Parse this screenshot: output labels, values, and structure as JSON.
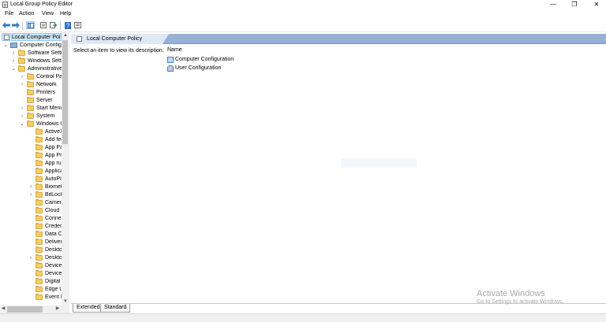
{
  "window": {
    "title": "Local Group Policy Editor",
    "minimize_glyph": "—",
    "restore_glyph": "❐",
    "close_glyph": "✕"
  },
  "menu": [
    "File",
    "Action",
    "View",
    "Help"
  ],
  "toolbar": {
    "back_icon": "back-arrow-icon",
    "forward_icon": "forward-arrow-icon",
    "show_tree_icon": "console-tree-icon",
    "properties_icon": "properties-icon",
    "export_icon": "export-list-icon",
    "help_icon": "help-icon",
    "filter_icon": "filter-icon"
  },
  "tree": {
    "root": "Local Computer Policy",
    "items": [
      {
        "label": "Computer Configuration",
        "expanded": true,
        "icon": "computer-icon"
      },
      {
        "label": "Software Settings",
        "expanded": false,
        "icon": "folder-icon"
      },
      {
        "label": "Windows Settings",
        "expanded": false,
        "icon": "folder-icon"
      },
      {
        "label": "Administrative Templates",
        "expanded": true,
        "icon": "folder-icon"
      },
      {
        "label": "Control Panel",
        "expanded": false,
        "icon": "folder-icon"
      },
      {
        "label": "Network",
        "expanded": false,
        "icon": "folder-icon"
      },
      {
        "label": "Printers",
        "icon": "folder-icon"
      },
      {
        "label": "Server",
        "icon": "folder-icon"
      },
      {
        "label": "Start Menu",
        "expanded": false,
        "icon": "folder-icon"
      },
      {
        "label": "System",
        "expanded": false,
        "icon": "folder-icon"
      },
      {
        "label": "Windows Components",
        "expanded": true,
        "icon": "folder-icon"
      },
      {
        "label": "ActiveX",
        "icon": "folder-icon"
      },
      {
        "label": "Add features",
        "icon": "folder-icon"
      },
      {
        "label": "App Package",
        "icon": "folder-icon"
      },
      {
        "label": "App Privacy",
        "icon": "folder-icon"
      },
      {
        "label": "App runtime",
        "icon": "folder-icon"
      },
      {
        "label": "Application",
        "icon": "folder-icon"
      },
      {
        "label": "AutoPlay",
        "icon": "folder-icon"
      },
      {
        "label": "Biometrics",
        "expanded": false,
        "icon": "folder-icon"
      },
      {
        "label": "BitLocker",
        "expanded": false,
        "icon": "folder-icon"
      },
      {
        "label": "Camera",
        "icon": "folder-icon"
      },
      {
        "label": "Cloud",
        "icon": "folder-icon"
      },
      {
        "label": "Connect",
        "icon": "folder-icon"
      },
      {
        "label": "Credential",
        "icon": "folder-icon"
      },
      {
        "label": "Data Collection",
        "icon": "folder-icon"
      },
      {
        "label": "Delivery",
        "icon": "folder-icon"
      },
      {
        "label": "Desktop",
        "icon": "folder-icon"
      },
      {
        "label": "Desktop Window",
        "expanded": false,
        "icon": "folder-icon"
      },
      {
        "label": "Device",
        "icon": "folder-icon"
      },
      {
        "label": "Device",
        "icon": "folder-icon"
      },
      {
        "label": "Digital",
        "icon": "folder-icon"
      },
      {
        "label": "Edge UI",
        "icon": "folder-icon"
      },
      {
        "label": "Event Forwarding",
        "icon": "folder-icon"
      }
    ]
  },
  "details": {
    "header": "Local Computer Policy",
    "description": "Select an item to view its description.",
    "column_name": "Name",
    "items": [
      {
        "label": "Computer Configuration",
        "icon": "computer-config-icon"
      },
      {
        "label": "User Configuration",
        "icon": "user-config-icon"
      }
    ]
  },
  "tabs": [
    "Extended",
    "Standard"
  ],
  "watermark": {
    "title": "Activate Windows",
    "subtitle": "Go to Settings to activate Windows."
  },
  "colors": {
    "header_blue": "#97b1d5",
    "selection": "#cce4f7",
    "folder": "#f6cf63"
  }
}
